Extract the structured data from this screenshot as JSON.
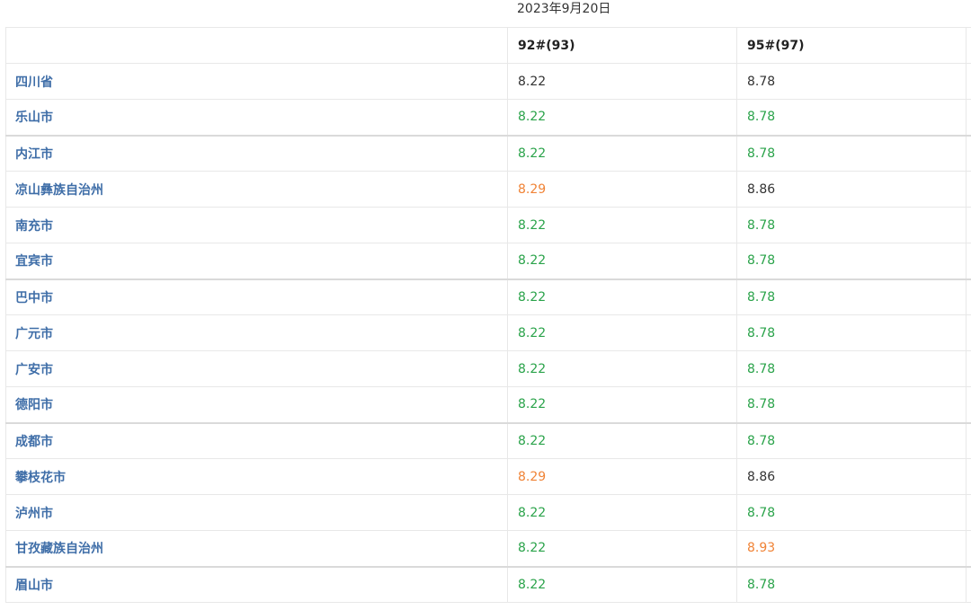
{
  "header": {
    "date": "2023年9月20日"
  },
  "table": {
    "columns": {
      "region": "",
      "fuel_92": "92#(93)",
      "fuel_95": "95#(97)"
    },
    "rows": [
      {
        "region": "四川省",
        "p92": "8.22",
        "p95": "8.78",
        "c92": "normal",
        "c95": "normal"
      },
      {
        "region": "乐山市",
        "p92": "8.22",
        "p95": "8.78",
        "c92": "green",
        "c95": "green"
      },
      {
        "region": "内江市",
        "p92": "8.22",
        "p95": "8.78",
        "c92": "green",
        "c95": "green"
      },
      {
        "region": "凉山彝族自治州",
        "p92": "8.29",
        "p95": "8.86",
        "c92": "orange",
        "c95": "normal"
      },
      {
        "region": "南充市",
        "p92": "8.22",
        "p95": "8.78",
        "c92": "green",
        "c95": "green"
      },
      {
        "region": "宜宾市",
        "p92": "8.22",
        "p95": "8.78",
        "c92": "green",
        "c95": "green"
      },
      {
        "region": "巴中市",
        "p92": "8.22",
        "p95": "8.78",
        "c92": "green",
        "c95": "green"
      },
      {
        "region": "广元市",
        "p92": "8.22",
        "p95": "8.78",
        "c92": "green",
        "c95": "green"
      },
      {
        "region": "广安市",
        "p92": "8.22",
        "p95": "8.78",
        "c92": "green",
        "c95": "green"
      },
      {
        "region": "德阳市",
        "p92": "8.22",
        "p95": "8.78",
        "c92": "green",
        "c95": "green"
      },
      {
        "region": "成都市",
        "p92": "8.22",
        "p95": "8.78",
        "c92": "green",
        "c95": "green"
      },
      {
        "region": "攀枝花市",
        "p92": "8.29",
        "p95": "8.86",
        "c92": "orange",
        "c95": "normal"
      },
      {
        "region": "泸州市",
        "p92": "8.22",
        "p95": "8.78",
        "c92": "green",
        "c95": "green"
      },
      {
        "region": "甘孜藏族自治州",
        "p92": "8.22",
        "p95": "8.93",
        "c92": "green",
        "c95": "orange"
      },
      {
        "region": "眉山市",
        "p92": "8.22",
        "p95": "8.78",
        "c92": "green",
        "c95": "green"
      }
    ]
  },
  "colors": {
    "region_text": "#3f6ea8",
    "normal": "#333333",
    "green": "#2aa34a",
    "orange": "#f08336",
    "border": "#e8e8e8"
  }
}
